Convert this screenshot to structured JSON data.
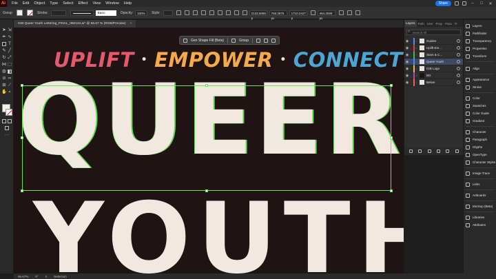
{
  "menubar": {
    "app_logo": "Ai",
    "items": [
      "File",
      "Edit",
      "Object",
      "Type",
      "Select",
      "Effect",
      "View",
      "Window",
      "Help"
    ],
    "share_label": "Share"
  },
  "controlbar": {
    "selection_label": "Group",
    "stroke_label": "Stroke:",
    "brush_label": "Basic",
    "opacity_label": "Opacity:",
    "opacity_value": "100%",
    "style_label": "Style:",
    "x_value": "2133.6688 p",
    "y_value": "766.3976 px",
    "w_value": "1710.2427 p",
    "h_value": "464.2599 px"
  },
  "document_tab": {
    "title": "IGB Queer Youth Lettering_FINAL_050124.ai* @ 66.67 % (RGB/Preview)",
    "close": "×"
  },
  "taskbar": {
    "gen_shape_fill": "Gen Shape Fill (Beta)",
    "group": "Group"
  },
  "artwork": {
    "word1": "UPLIFT",
    "word2": "EMPOWER",
    "word3": "CONNECT",
    "separator": "•",
    "headline1": "QUEER",
    "headline2": "YOUTH"
  },
  "layers_panel": {
    "tabs": [
      "Layers",
      "Path",
      "Liter",
      "Prop",
      "Para",
      "Tr"
    ],
    "search_placeholder": "Search All",
    "layers": [
      {
        "name": "Guides",
        "color": "#4f8cff",
        "selected": false
      },
      {
        "name": "Uplift Em...",
        "color": "#e04040",
        "selected": false
      },
      {
        "name": "Stars & C...",
        "color": "#40c040",
        "selected": false
      },
      {
        "name": "Queer Youth",
        "color": "#4f8cff",
        "selected": true
      },
      {
        "name": "IGB Logo",
        "color": "#e0c040",
        "selected": false
      },
      {
        "name": "BG",
        "color": "#c040c0",
        "selected": false
      },
      {
        "name": "Below",
        "color": "#e07030",
        "selected": false
      }
    ]
  },
  "dock": {
    "items": [
      {
        "label": "Layers",
        "icon": "layers-icon"
      },
      {
        "label": "Pathfinder",
        "icon": "pathfinder-icon"
      },
      {
        "label": "Transparency",
        "icon": "transparency-icon"
      },
      {
        "label": "Properties",
        "icon": "properties-icon"
      },
      {
        "label": "Transform",
        "icon": "transform-icon"
      },
      {
        "label": "Align",
        "icon": "align-icon"
      },
      {
        "label": "Appearance",
        "icon": "appearance-icon"
      },
      {
        "label": "Stroke",
        "icon": "stroke-icon"
      },
      {
        "label": "Color",
        "icon": "color-icon"
      },
      {
        "label": "Swatches",
        "icon": "swatches-icon"
      },
      {
        "label": "Color Guide",
        "icon": "color-guide-icon"
      },
      {
        "label": "Gradient",
        "icon": "gradient-icon"
      },
      {
        "label": "Character",
        "icon": "character-icon"
      },
      {
        "label": "Paragraph",
        "icon": "paragraph-icon"
      },
      {
        "label": "Glyphs",
        "icon": "glyphs-icon"
      },
      {
        "label": "OpenType",
        "icon": "opentype-icon"
      },
      {
        "label": "Character Styles",
        "icon": "character-styles-icon"
      },
      {
        "label": "Image Trace",
        "icon": "image-trace-icon"
      },
      {
        "label": "Links",
        "icon": "links-icon"
      },
      {
        "label": "Artboards",
        "icon": "artboards-icon"
      },
      {
        "label": "Mockup (Beta)",
        "icon": "mockup-icon"
      },
      {
        "label": "Libraries",
        "icon": "libraries-icon"
      },
      {
        "label": "Attributes",
        "icon": "attributes-icon"
      }
    ]
  },
  "statusbar": {
    "zoom": "66.67%",
    "rotation": "0°",
    "artboard": "1",
    "mode": "Selection"
  },
  "colors": {
    "canvas_bg": "#201314",
    "uplift": "#e45a6d",
    "empower": "#f4a94d",
    "connect": "#4ca6d2",
    "headline": "#f1e9df",
    "selection": "#6ee05a",
    "layer_selected": "#3c4a66"
  }
}
